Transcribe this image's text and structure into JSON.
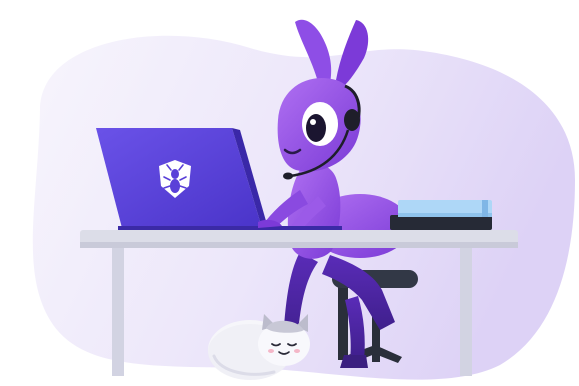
{
  "illustration": {
    "subject": "ant-agent-at-desk",
    "icons": [
      "ant-logo-icon",
      "headset-icon",
      "cat-icon"
    ]
  },
  "colors": {
    "blob_light": "#f3effb",
    "blob_dark": "#e3daf8",
    "laptop_purple": "#6b4fe0",
    "ant_purple": "#9c5ae6",
    "ant_dark": "#6e2fc9",
    "desk": "#dcdde8",
    "chair": "#2e3440",
    "books_top": "#a9d4f7"
  }
}
